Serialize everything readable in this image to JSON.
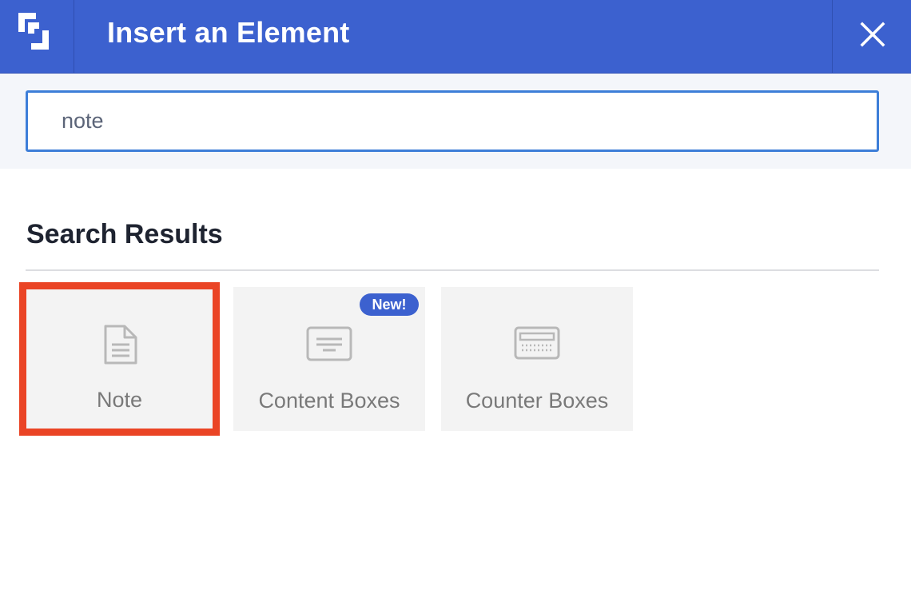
{
  "header": {
    "title": "Insert an Element",
    "logo_icon": "brand-logo-icon",
    "close_icon": "close-icon"
  },
  "search": {
    "value": "note"
  },
  "results": {
    "heading": "Search Results",
    "items": [
      {
        "label": "Note",
        "icon": "document-icon",
        "selected": true
      },
      {
        "label": "Content Boxes",
        "icon": "content-box-icon",
        "badge": "New!"
      },
      {
        "label": "Counter Boxes",
        "icon": "counter-box-icon"
      }
    ]
  },
  "colors": {
    "header_bg": "#3c61cf",
    "input_border": "#3d7ed8",
    "selection_outline": "#ea4425",
    "badge_bg": "#3c61cf"
  }
}
